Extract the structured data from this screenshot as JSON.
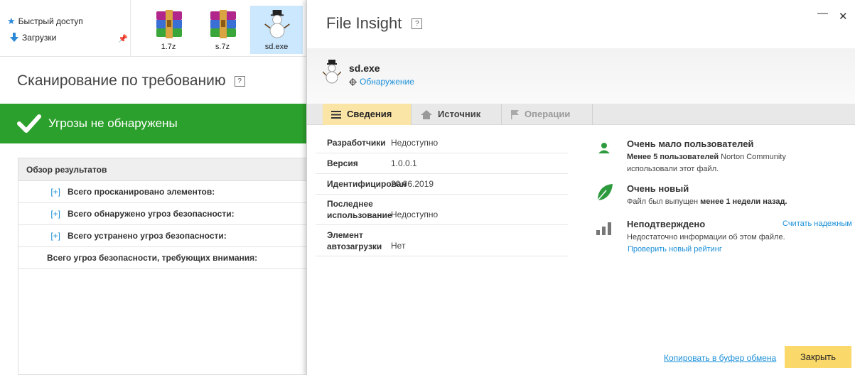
{
  "explorer": {
    "quick_access": "Быстрый доступ",
    "downloads": "Загрузки",
    "files": [
      {
        "name": "1.7z",
        "icon": "winrar-archive-icon"
      },
      {
        "name": "s.7z",
        "icon": "winrar-archive-icon"
      },
      {
        "name": "sd.exe",
        "icon": "snowman-icon",
        "selected": true
      }
    ]
  },
  "scan": {
    "title": "Сканирование по требованию",
    "help": "?",
    "status": "Угрозы не обнаружены",
    "status_color": "#2ca02c",
    "results_header": "Обзор результатов",
    "expand": "[+]",
    "rows": [
      "Всего просканировано элементов:",
      "Всего обнаружено угроз безопасности:",
      "Всего устранено угроз безопасности:",
      "Всего угроз безопасности, требующих внимания:"
    ]
  },
  "dialog": {
    "title": "File Insight",
    "help": "?",
    "minimize": "—",
    "close": "✕",
    "file_name": "sd.exe",
    "file_link": "Обнаружение",
    "tabs": [
      "Сведения",
      "Источник",
      "Операции"
    ],
    "details": [
      {
        "key": "Разработчики",
        "value": "Недоступно"
      },
      {
        "key": "Версия",
        "value": "1.0.0.1"
      },
      {
        "key": "Идентифицирован",
        "value": "20.06.2019"
      },
      {
        "key": "Последнее использование",
        "value": "Недоступно"
      },
      {
        "key": "Элемент автозагрузки",
        "value": "Нет"
      }
    ],
    "reputation": {
      "users_title": "Очень мало пользователей",
      "users_bold": "Менее 5 пользователей",
      "users_rest1": " Norton Community",
      "users_rest2": "использовали этот файл.",
      "new_title": "Очень новый",
      "new_text": "Файл был выпущен ",
      "new_bold": "менее 1 недели назад.",
      "trust_title": "Неподтверждено",
      "trust_link": "Считать надежным",
      "trust_text": "Недостаточно информации об этом файле.",
      "trust_check": "Проверить новый рейтинг"
    },
    "copy_link": "Копировать в буфер обмена",
    "close_button": "Закрыть",
    "accent": "#fbd86a"
  }
}
